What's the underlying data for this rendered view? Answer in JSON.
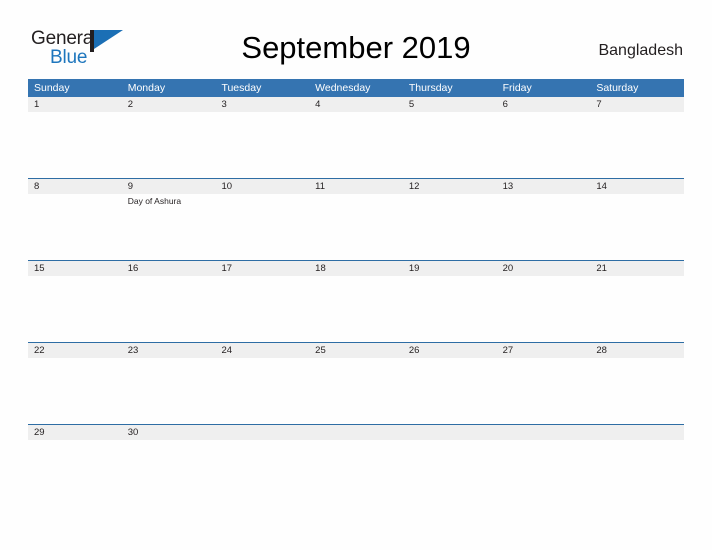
{
  "brand": {
    "name_part1": "General",
    "name_part2": "Blue",
    "mark_icon": "flag-triangle-icon",
    "color_dark": "#231f20",
    "color_blue": "#1e76bd"
  },
  "header": {
    "title": "September 2019",
    "country": "Bangladesh"
  },
  "theme": {
    "header_blue": "#3574b1",
    "rule_blue": "#2e6da4",
    "band_gray": "#efefef",
    "page_background": "#fefefe",
    "text": "#231f20"
  },
  "calendar": {
    "month": "September",
    "year": "2019",
    "weekdays": [
      "Sunday",
      "Monday",
      "Tuesday",
      "Wednesday",
      "Thursday",
      "Friday",
      "Saturday"
    ],
    "weeks": [
      {
        "days": [
          {
            "num": "1",
            "events": []
          },
          {
            "num": "2",
            "events": []
          },
          {
            "num": "3",
            "events": []
          },
          {
            "num": "4",
            "events": []
          },
          {
            "num": "5",
            "events": []
          },
          {
            "num": "6",
            "events": []
          },
          {
            "num": "7",
            "events": []
          }
        ]
      },
      {
        "days": [
          {
            "num": "8",
            "events": []
          },
          {
            "num": "9",
            "events": [
              "Day of Ashura"
            ]
          },
          {
            "num": "10",
            "events": []
          },
          {
            "num": "11",
            "events": []
          },
          {
            "num": "12",
            "events": []
          },
          {
            "num": "13",
            "events": []
          },
          {
            "num": "14",
            "events": []
          }
        ]
      },
      {
        "days": [
          {
            "num": "15",
            "events": []
          },
          {
            "num": "16",
            "events": []
          },
          {
            "num": "17",
            "events": []
          },
          {
            "num": "18",
            "events": []
          },
          {
            "num": "19",
            "events": []
          },
          {
            "num": "20",
            "events": []
          },
          {
            "num": "21",
            "events": []
          }
        ]
      },
      {
        "days": [
          {
            "num": "22",
            "events": []
          },
          {
            "num": "23",
            "events": []
          },
          {
            "num": "24",
            "events": []
          },
          {
            "num": "25",
            "events": []
          },
          {
            "num": "26",
            "events": []
          },
          {
            "num": "27",
            "events": []
          },
          {
            "num": "28",
            "events": []
          }
        ]
      },
      {
        "days": [
          {
            "num": "29",
            "events": []
          },
          {
            "num": "30",
            "events": []
          },
          {
            "num": "",
            "events": []
          },
          {
            "num": "",
            "events": []
          },
          {
            "num": "",
            "events": []
          },
          {
            "num": "",
            "events": []
          },
          {
            "num": "",
            "events": []
          }
        ]
      }
    ]
  }
}
